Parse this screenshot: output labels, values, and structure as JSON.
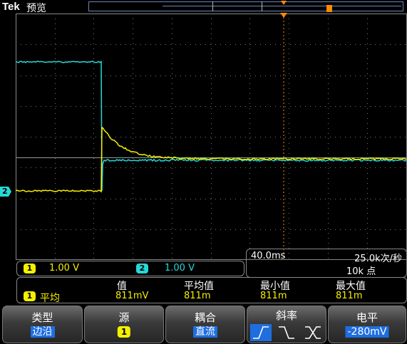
{
  "header": {
    "brand": "Tek",
    "mode": "预览"
  },
  "channels": [
    {
      "id": "1",
      "scale": "1.00 V",
      "color": "#f4f000"
    },
    {
      "id": "2",
      "scale": "1.00 V",
      "color": "#27d8d8"
    }
  ],
  "ch2_marker_label": "2",
  "timebase": {
    "scale": "40.0ms",
    "sample_rate": "25.0k次/秒",
    "record_length": "10k 点"
  },
  "measurement": {
    "channel": "1",
    "name": "平均",
    "headers": [
      "值",
      "平均值",
      "最小值",
      "最大值"
    ],
    "values": [
      "811mV",
      "811m",
      "811m",
      "811m"
    ]
  },
  "menu": {
    "type": {
      "label": "类型",
      "value": "边沿"
    },
    "source": {
      "label": "源",
      "value": "1"
    },
    "coupling": {
      "label": "耦合",
      "value": "直流"
    },
    "slope": {
      "label": "斜率",
      "options": [
        "rising-edge-icon",
        "falling-edge-icon",
        "either-edge-icon"
      ],
      "selected": 0
    },
    "level": {
      "label": "电平",
      "value": "-280mV"
    }
  },
  "colors": {
    "trigger": "#ff8a00",
    "ch1": "#f4f000",
    "ch2": "#27d8d8",
    "menu_highlight": "#1e6ee0"
  }
}
